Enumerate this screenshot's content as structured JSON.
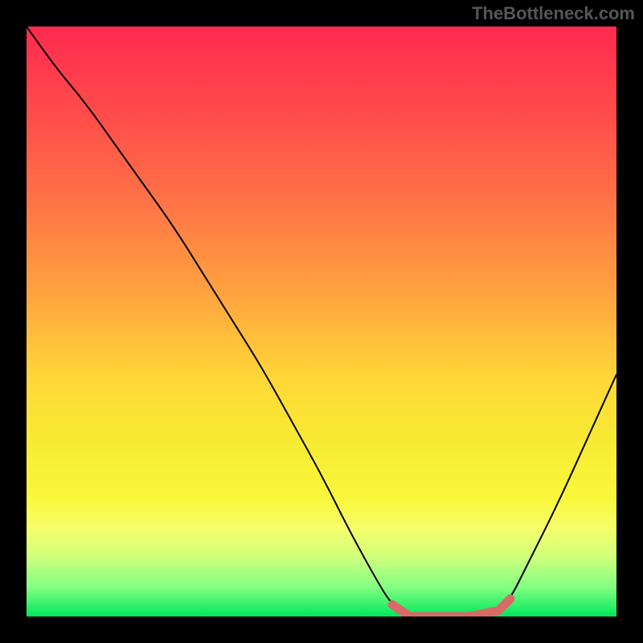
{
  "watermark": "TheBottleneck.com",
  "colors": {
    "background": "#000000",
    "curve": "#000000",
    "highlight": "#d86a66",
    "gradient_top": "#ff2a4f",
    "gradient_bottom": "#00e85c"
  },
  "chart_data": {
    "type": "line",
    "title": "",
    "xlabel": "",
    "ylabel": "",
    "xlim": [
      0,
      100
    ],
    "ylim": [
      0,
      100
    ],
    "series": [
      {
        "name": "bottleneck_curve",
        "x": [
          0,
          5,
          10,
          15,
          20,
          25,
          30,
          35,
          40,
          45,
          50,
          55,
          60,
          62,
          65,
          70,
          75,
          80,
          82,
          85,
          90,
          95,
          100
        ],
        "y": [
          100,
          93,
          87,
          80,
          73,
          66,
          58,
          50,
          42,
          33,
          24,
          14,
          5,
          2,
          0,
          0,
          0,
          1,
          3,
          9,
          19,
          30,
          41
        ]
      }
    ],
    "highlight_range": {
      "x": [
        62,
        65,
        70,
        75,
        80,
        82
      ],
      "y": [
        2,
        0,
        0,
        0,
        1,
        3
      ]
    }
  }
}
